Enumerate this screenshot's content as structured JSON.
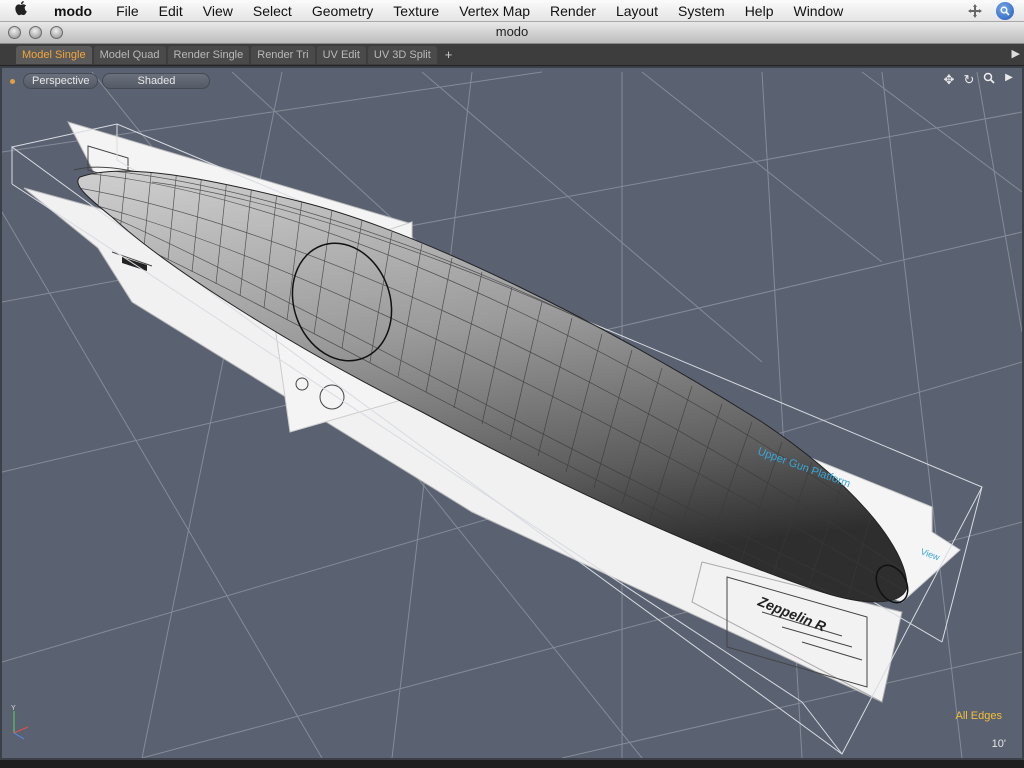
{
  "menubar": {
    "app_name": "modo",
    "items": [
      "File",
      "Edit",
      "View",
      "Select",
      "Geometry",
      "Texture",
      "Vertex Map",
      "Render",
      "Layout",
      "System",
      "Help",
      "Window"
    ]
  },
  "window": {
    "title": "modo"
  },
  "tabs": [
    {
      "label": "Model Single",
      "active": true
    },
    {
      "label": "Model Quad",
      "active": false
    },
    {
      "label": "Render Single",
      "active": false
    },
    {
      "label": "Render Tri",
      "active": false
    },
    {
      "label": "UV Edit",
      "active": false
    },
    {
      "label": "UV 3D Split",
      "active": false
    }
  ],
  "tab_add": "+",
  "viewport": {
    "view_mode": "Perspective",
    "shading_mode": "Shaded",
    "selection_mode_label": "All Edges",
    "grid_unit": "10'",
    "reference_text": {
      "blueprint_title": "Zeppelin R",
      "label_upper": "Upper Gun Platform",
      "label_view": "View"
    }
  },
  "colors": {
    "viewport_bg": "#5a6170",
    "active_tab_text": "#f3a53a",
    "all_edges_text": "#f2c038",
    "annotation_blue": "#3aa6d8"
  },
  "icons": [
    "apple-icon",
    "move-icon",
    "spotlight-icon",
    "pan-icon",
    "rotate-icon",
    "zoom-icon",
    "expand-icon",
    "axis-gizmo-icon"
  ]
}
